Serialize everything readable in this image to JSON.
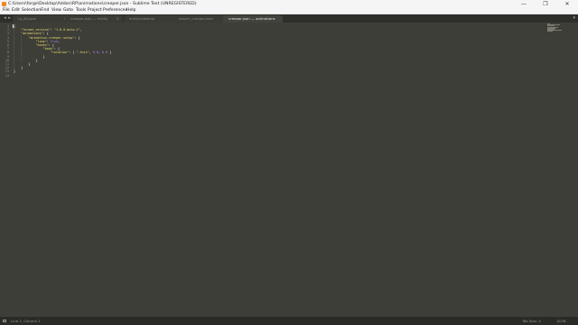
{
  "window": {
    "title": "C:\\Users\\forge\\Desktop\\Addon\\RP\\animations\\creeper.json - Sublime Text (UNREGISTERED)",
    "minimize": "—",
    "maximize": "❐",
    "close": "✕"
  },
  "menu": [
    "File",
    "Edit",
    "Selection",
    "Find",
    "View",
    "Goto",
    "Tools",
    "Project",
    "Preferences",
    "Help"
  ],
  "tabs": [
    {
      "label": "rp_00.json",
      "active": false
    },
    {
      "label": "creeper.json — entity",
      "active": false
    },
    {
      "label": "entity.material",
      "active": false
    },
    {
      "label": "player_creeper.json",
      "active": false
    },
    {
      "label": "creeper.json — animations",
      "active": false
    }
  ],
  "tab_close_glyph": "×",
  "code": {
    "line_numbers": [
      "1",
      "2",
      "3",
      "4",
      "5",
      "6",
      "7",
      "8",
      "9",
      "10",
      "11",
      "12",
      "13",
      "14"
    ],
    "lines": [
      [
        {
          "t": "{",
          "c": "plain"
        }
      ],
      [
        {
          "t": "    ",
          "c": "plain"
        },
        {
          "t": "\"format_version\"",
          "c": "str"
        },
        {
          "t": ": ",
          "c": "plain"
        },
        {
          "t": "\"1.8.0-beta.1\"",
          "c": "str"
        },
        {
          "t": ",",
          "c": "plain"
        }
      ],
      [
        {
          "t": "    ",
          "c": "plain"
        },
        {
          "t": "\"animations\"",
          "c": "str"
        },
        {
          "t": ": {",
          "c": "plain"
        }
      ],
      [
        {
          "t": "        ",
          "c": "plain"
        },
        {
          "t": "\"animation.creeper.setup\"",
          "c": "str"
        },
        {
          "t": ": {",
          "c": "plain"
        }
      ],
      [
        {
          "t": "            ",
          "c": "plain"
        },
        {
          "t": "\"loop\"",
          "c": "str"
        },
        {
          "t": ": ",
          "c": "plain"
        },
        {
          "t": "true",
          "c": "kw"
        },
        {
          "t": ",",
          "c": "plain"
        }
      ],
      [
        {
          "t": "            ",
          "c": "plain"
        },
        {
          "t": "\"bones\"",
          "c": "str"
        },
        {
          "t": ": {",
          "c": "plain"
        }
      ],
      [
        {
          "t": "                ",
          "c": "plain"
        },
        {
          "t": "\"body\"",
          "c": "str"
        },
        {
          "t": ": {",
          "c": "plain"
        }
      ],
      [
        {
          "t": "                    ",
          "c": "plain"
        },
        {
          "t": "\"rotation\"",
          "c": "str"
        },
        {
          "t": ": [ ",
          "c": "plain"
        },
        {
          "t": "\"-this\"",
          "c": "str"
        },
        {
          "t": ", ",
          "c": "plain"
        },
        {
          "t": "0.0",
          "c": "kw"
        },
        {
          "t": ", ",
          "c": "plain"
        },
        {
          "t": "0.0",
          "c": "kw"
        },
        {
          "t": " ]",
          "c": "plain"
        }
      ],
      [
        {
          "t": "                }",
          "c": "plain"
        }
      ],
      [
        {
          "t": "            }",
          "c": "plain"
        }
      ],
      [
        {
          "t": "        }",
          "c": "plain"
        }
      ],
      [
        {
          "t": "    }",
          "c": "plain"
        }
      ],
      [
        {
          "t": "}",
          "c": "plain"
        }
      ],
      [
        {
          "t": "",
          "c": "plain"
        }
      ]
    ]
  },
  "status": {
    "position": "Line 1, Column 1",
    "tab_size": "Tab Size: 4",
    "syntax": "JSON"
  },
  "colors": {
    "editor_bg": "#3e3e38",
    "string": "#e6db74",
    "constant": "#ae81ff",
    "text": "#f8f8f2"
  }
}
